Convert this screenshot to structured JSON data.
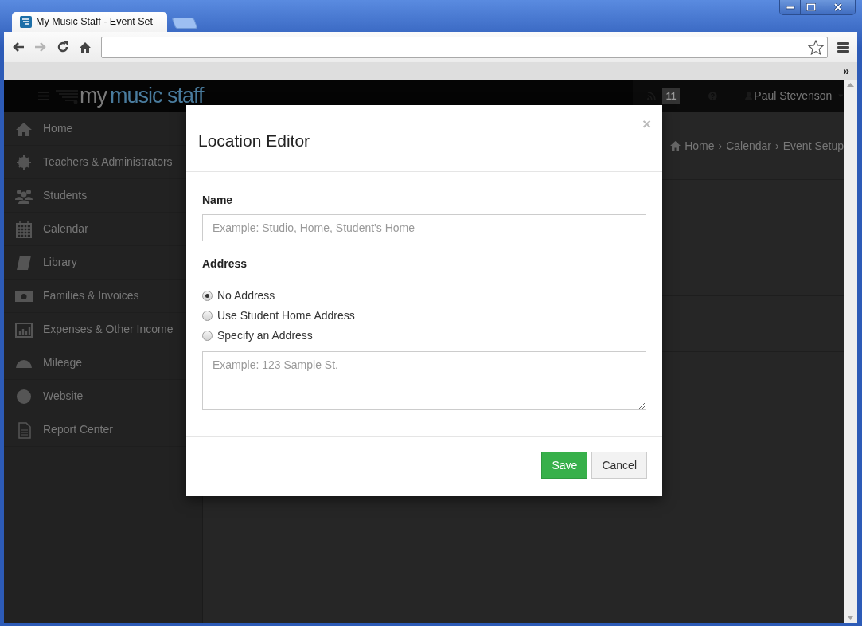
{
  "browser": {
    "tab_title": "My Music Staff - Event Set",
    "forward_disabled": true,
    "overflow": "»"
  },
  "navbar": {
    "logo_prefix": "my",
    "logo_text": "music staff",
    "feed_count": "11",
    "user": "Paul Stevenson"
  },
  "sidebar": {
    "items": [
      {
        "label": "Home"
      },
      {
        "label": "Teachers & Administrators"
      },
      {
        "label": "Students"
      },
      {
        "label": "Calendar"
      },
      {
        "label": "Library"
      },
      {
        "label": "Families & Invoices"
      },
      {
        "label": "Expenses & Other Income"
      },
      {
        "label": "Mileage"
      },
      {
        "label": "Website"
      },
      {
        "label": "Report Center"
      }
    ]
  },
  "breadcrumb": {
    "separator": "›",
    "items": [
      "Home",
      "Calendar",
      "Event Setup"
    ]
  },
  "modal": {
    "title": "Location Editor",
    "close": "×",
    "name_label": "Name",
    "name_placeholder": "Example: Studio, Home, Student's Home",
    "address_label": "Address",
    "address_options": [
      {
        "label": "No Address",
        "selected": true
      },
      {
        "label": "Use Student Home Address",
        "selected": false
      },
      {
        "label": "Specify an Address",
        "selected": false
      }
    ],
    "address_placeholder": "Example: 123 Sample St.",
    "buttons": [
      {
        "kind": "primary",
        "label": "Save"
      },
      {
        "kind": "default",
        "label": "Cancel"
      }
    ]
  }
}
